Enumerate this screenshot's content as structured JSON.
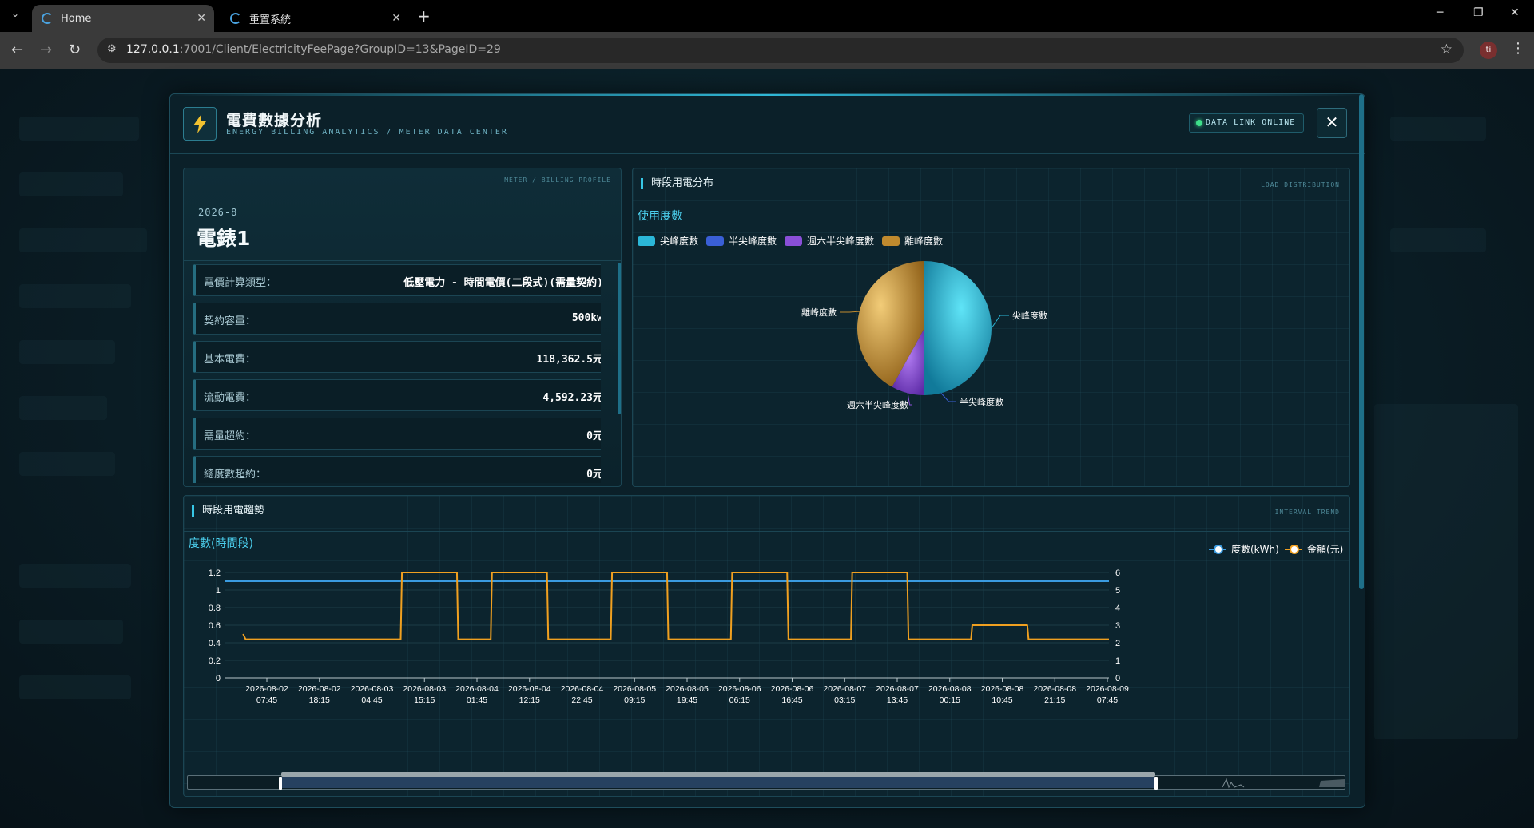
{
  "browser": {
    "tabs": [
      {
        "label": "Home",
        "active": true
      },
      {
        "label": "重置系統",
        "active": false
      }
    ],
    "url_host": "127.0.0.1",
    "url_rest": ":7001/Client/ElectricityFeePage?GroupID=13&PageID=29",
    "profile_initial": "ti"
  },
  "modal": {
    "title": "電費數據分析",
    "subtitle": "ENERGY BILLING ANALYTICS / METER DATA CENTER",
    "status": "DATA LINK ONLINE",
    "close": "✕"
  },
  "meter_panel": {
    "tag": "METER / BILLING PROFILE",
    "period": "2026-8",
    "meter_name": "電錶1",
    "rows": [
      {
        "label": "電價計算類型：",
        "value": "低壓電力 - 時間電價(二段式)(需量契約)"
      },
      {
        "label": "契約容量：",
        "value": "500kw"
      },
      {
        "label": "基本電費：",
        "value": "118,362.5元"
      },
      {
        "label": "流動電費：",
        "value": "4,592.23元"
      },
      {
        "label": "需量超約：",
        "value": "0元"
      },
      {
        "label": "總度數超約：",
        "value": "0元"
      }
    ]
  },
  "pie_panel": {
    "title": "時段用電分布",
    "tag": "LOAD DISTRIBUTION",
    "subtitle": "使用度數",
    "colors": {
      "peak": "#2bb7d8",
      "half_peak": "#3a5fd6",
      "sat_half_peak": "#8a4fd8",
      "off_peak": "#c08a2e"
    }
  },
  "trend_panel": {
    "title": "時段用電趨勢",
    "tag": "INTERVAL TREND",
    "subtitle": "度數(時間段)",
    "legend_kwh": "度數(kWh)",
    "legend_cost": "金額(元)"
  },
  "chart_data": [
    {
      "type": "pie",
      "title": "使用度數",
      "categories": [
        "尖峰度數",
        "半尖峰度數",
        "週六半尖峰度數",
        "離峰度數"
      ],
      "values": [
        50,
        0,
        8,
        42
      ]
    },
    {
      "type": "line",
      "title": "度數(時間段)",
      "x": [
        "2026-08-02 07:45",
        "2026-08-02 18:15",
        "2026-08-03 04:45",
        "2026-08-03 15:15",
        "2026-08-04 01:45",
        "2026-08-04 12:15",
        "2026-08-04 22:45",
        "2026-08-05 09:15",
        "2026-08-05 19:45",
        "2026-08-06 06:15",
        "2026-08-06 16:45",
        "2026-08-07 03:15",
        "2026-08-07 13:45",
        "2026-08-08 00:15",
        "2026-08-08 10:45",
        "2026-08-08 21:15",
        "2026-08-09 07:45"
      ],
      "ylim_left": [
        0,
        1.2
      ],
      "yticks_left": [
        "0",
        "0.2",
        "0.4",
        "0.6",
        "0.8",
        "1",
        "1.2"
      ],
      "ylim_right": [
        0,
        6
      ],
      "yticks_right": [
        "0",
        "1",
        "2",
        "3",
        "4",
        "5",
        "6"
      ],
      "series": [
        {
          "name": "度數(kWh)",
          "axis": "left",
          "color": "#3a9be0",
          "values": [
            1.1,
            1.1,
            1.1,
            1.1,
            1.1,
            1.1,
            1.1,
            1.1,
            1.1,
            1.1,
            1.1,
            1.1,
            1.1,
            1.1,
            1.1,
            1.1,
            1.1
          ]
        },
        {
          "name": "金額(元)",
          "axis": "right",
          "color": "#f0a020",
          "steps": [
            [
              "2026-08-02 03:00",
              2.5
            ],
            [
              "2026-08-02 03:30",
              2.2
            ],
            [
              "2026-08-03 10:30",
              2.2
            ],
            [
              "2026-08-03 10:45",
              6
            ],
            [
              "2026-08-03 21:45",
              6
            ],
            [
              "2026-08-03 22:00",
              2.2
            ],
            [
              "2026-08-04 04:30",
              2.2
            ],
            [
              "2026-08-04 04:45",
              6
            ],
            [
              "2026-08-04 15:45",
              6
            ],
            [
              "2026-08-04 16:00",
              2.2
            ],
            [
              "2026-08-05 04:30",
              2.2
            ],
            [
              "2026-08-05 04:45",
              6
            ],
            [
              "2026-08-05 15:45",
              6
            ],
            [
              "2026-08-05 16:00",
              2.2
            ],
            [
              "2026-08-06 04:30",
              2.2
            ],
            [
              "2026-08-06 04:45",
              6
            ],
            [
              "2026-08-06 15:45",
              6
            ],
            [
              "2026-08-06 16:00",
              2.2
            ],
            [
              "2026-08-07 04:30",
              2.2
            ],
            [
              "2026-08-07 04:45",
              6
            ],
            [
              "2026-08-07 15:45",
              6
            ],
            [
              "2026-08-07 16:00",
              2.2
            ],
            [
              "2026-08-08 04:30",
              2.2
            ],
            [
              "2026-08-08 04:45",
              3
            ],
            [
              "2026-08-08 15:45",
              3
            ],
            [
              "2026-08-08 16:00",
              2.2
            ],
            [
              "2026-08-09 09:00",
              2.2
            ]
          ]
        }
      ],
      "legend_position": "top-right",
      "zoom_slider": true
    }
  ]
}
